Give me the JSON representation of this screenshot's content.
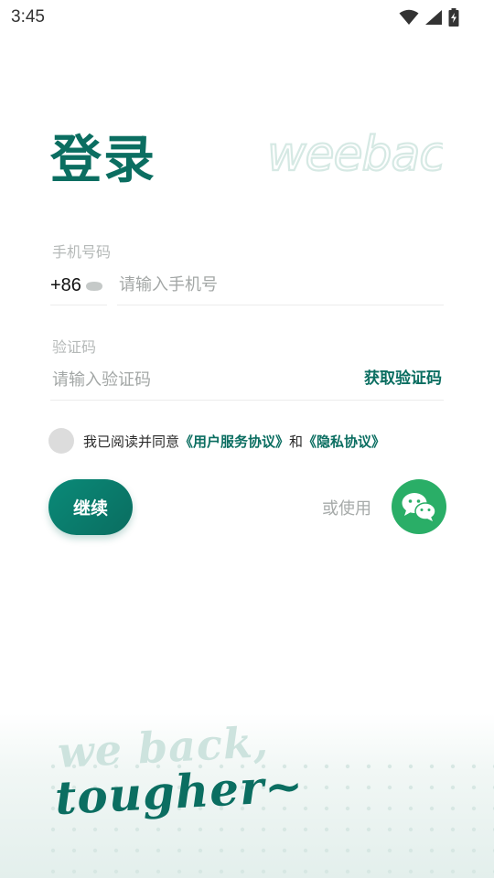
{
  "status_bar": {
    "time": "3:45",
    "icons": [
      "wifi-icon",
      "signal-icon",
      "battery-charging-icon"
    ]
  },
  "login": {
    "title": "登录",
    "brand": "weebac"
  },
  "phone_field": {
    "label": "手机号码",
    "country_code": "+86",
    "placeholder": "请输入手机号",
    "value": ""
  },
  "code_field": {
    "label": "验证码",
    "placeholder": "请输入验证码",
    "value": "",
    "get_code_label": "获取验证码"
  },
  "agreement": {
    "checked": false,
    "prefix": "我已阅读并同意",
    "user_agreement": "《用户服务协议》",
    "conjunction": "和",
    "privacy_policy": "《隐私协议》"
  },
  "actions": {
    "continue_label": "继续",
    "or_use_label": "或使用",
    "alt_login": "wechat-icon"
  },
  "slogan": {
    "line1": "we back,",
    "line2": "tougher~"
  },
  "colors": {
    "accent": "#0b6e61",
    "wechat": "#2aae67",
    "muted": "#a6aaa9"
  }
}
